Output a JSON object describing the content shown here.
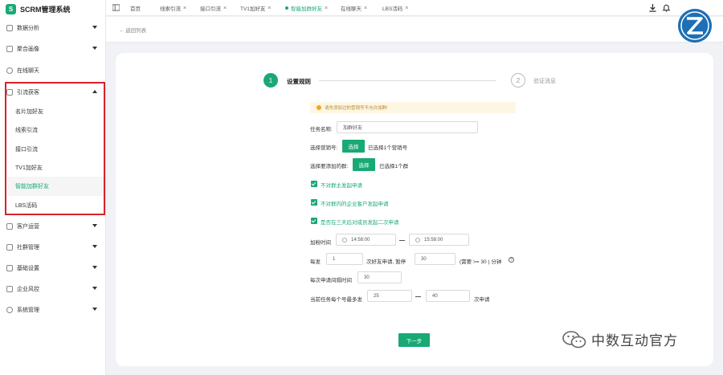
{
  "app": {
    "logo_char": "S",
    "title": "SCRM管理系统"
  },
  "sidebar": {
    "items": [
      {
        "label": "数据分析"
      },
      {
        "label": "聚合画像"
      },
      {
        "label": "在线聊天"
      },
      {
        "label": "引流获客"
      },
      {
        "label": "客户运营"
      },
      {
        "label": "社群管理"
      },
      {
        "label": "基础设置"
      },
      {
        "label": "企业风控"
      },
      {
        "label": "系统管理"
      }
    ],
    "sub_items": [
      {
        "label": "名片加好友"
      },
      {
        "label": "线索引流"
      },
      {
        "label": "接口引流"
      },
      {
        "label": "TV1加好友"
      },
      {
        "label": "智能加群好友"
      },
      {
        "label": "LBS活码"
      }
    ]
  },
  "tabs": [
    {
      "label": "首页"
    },
    {
      "label": "线索引流"
    },
    {
      "label": "接口引流"
    },
    {
      "label": "TV1加好友"
    },
    {
      "label": "智能加群好友"
    },
    {
      "label": "在线聊天"
    },
    {
      "label": "LBS活码"
    }
  ],
  "back_link": "← 返回列表",
  "steps": {
    "step1_num": "1",
    "step1_label": "设置规则",
    "step2_num": "2",
    "step2_label": "验证消息"
  },
  "form": {
    "warning": "请先添加过的营销号不允许加群!",
    "task_name_label": "任务名称:",
    "task_name_value": "加群好友",
    "select_marketing_label": "选择营销号:",
    "select_btn": "选择",
    "selected_marketing": "已选择1个营销号",
    "select_group_label": "选择要添加的群:",
    "selected_group": "已选择1个群",
    "opt1": "不对群主发起申请",
    "opt2": "不对群内的企业客户发起申请",
    "opt3": "是否在三天后对成员发起二次申请",
    "time_label": "加粉时间",
    "time_start": "14:58:00",
    "time_end": "15:58:00",
    "every_label": "每发",
    "every_value": "1",
    "pause_label": "次好友申请, 暂停",
    "pause_value": "30",
    "pause_unit": "(需要 >= 30 ) 分钟",
    "interval_label": "每次申请间隔时间",
    "interval_value": "30",
    "max_label": "当前任务每个号最多发",
    "max_from": "25",
    "max_to": "40",
    "max_unit": "次申请",
    "next_btn": "下一步"
  },
  "watermark": "中数互动官方",
  "colors": {
    "primary": "#19a974",
    "highlight_border": "#d8222a"
  }
}
